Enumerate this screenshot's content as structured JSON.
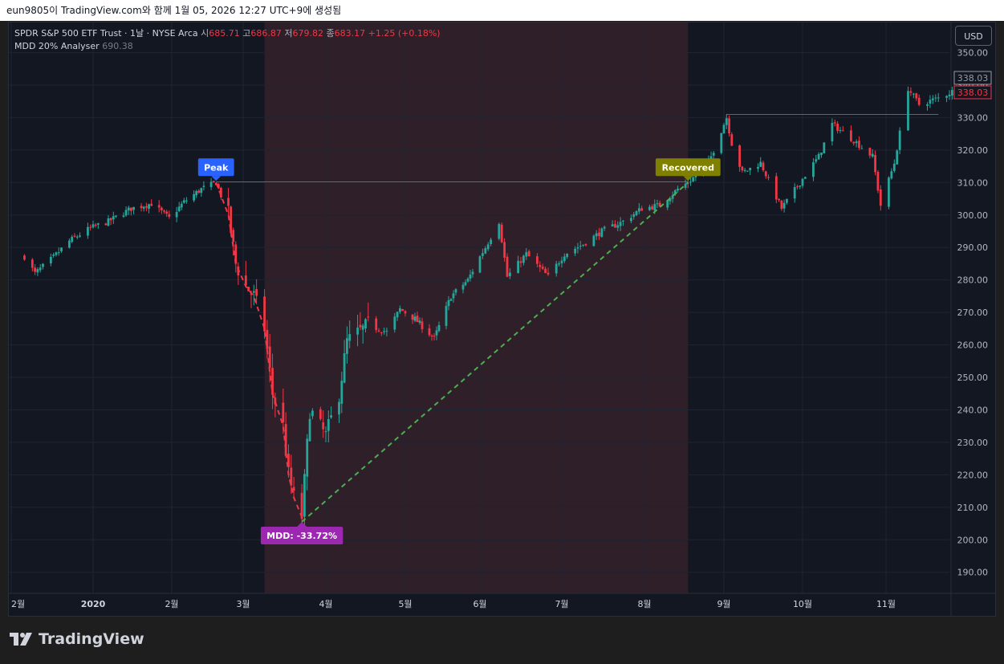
{
  "header": {
    "snapshot_text": "eun9805이 TradingView.com와 함께 1월 05, 2026 12:27 UTC+9에 생성됨"
  },
  "legend": {
    "symbol": "SPDR S&P 500 ETF Trust · 1날 · NYSE Arca",
    "open_label": "시",
    "open_value": "685.71",
    "high_label": "고",
    "high_value": "686.87",
    "low_label": "저",
    "low_value": "679.82",
    "close_label": "종",
    "close_value": "683.17",
    "change": "+1.25 (+0.18%)",
    "indicator_name": "MDD 20% Analyser",
    "indicator_value": "690.38"
  },
  "toolbar": {
    "currency": "USD"
  },
  "footer": {
    "brand": "TradingView"
  },
  "colors": {
    "up": "#26a69a",
    "down": "#f23645",
    "background": "#131722",
    "drawdown_zone": "#2f1f29",
    "peak_label": "#2962ff",
    "recovered_label": "#808000",
    "mdd_label": "#9c27b0",
    "recovery_line": "#4caf50",
    "drop_line": "#f23645"
  },
  "chart_data": {
    "type": "candlestick",
    "y_axis": {
      "min": 184,
      "max": 354,
      "ticks": [
        "190.00",
        "200.00",
        "210.00",
        "220.00",
        "230.00",
        "240.00",
        "250.00",
        "260.00",
        "270.00",
        "280.00",
        "290.00",
        "300.00",
        "310.00",
        "320.00",
        "330.00",
        "340.00",
        "350.00"
      ]
    },
    "x_axis_ticks": [
      {
        "label": "2월",
        "date": "2019-02-01"
      },
      {
        "label": "2020",
        "date": "2020-01-01"
      },
      {
        "label": "2월",
        "date": "2020-02-01"
      },
      {
        "label": "3월",
        "date": "2020-03-01"
      },
      {
        "label": "4월",
        "date": "2020-04-01"
      },
      {
        "label": "5월",
        "date": "2020-05-01"
      },
      {
        "label": "6월",
        "date": "2020-06-01"
      },
      {
        "label": "7월",
        "date": "2020-07-01"
      },
      {
        "label": "8월",
        "date": "2020-08-01"
      },
      {
        "label": "9월",
        "date": "2020-09-01"
      },
      {
        "label": "10월",
        "date": "2020-10-01"
      },
      {
        "label": "11월",
        "date": "2020-11-01"
      }
    ],
    "price_labels": [
      {
        "value": 338.03,
        "text": "338.03",
        "style": "outline"
      },
      {
        "value": 338.03,
        "text": "338.03",
        "style": "current"
      }
    ],
    "peak": {
      "label": "Peak",
      "date": "2020-02-19",
      "price": 310
    },
    "trough": {
      "label": "MDD: -33.72%",
      "date": "2020-03-23",
      "price": 205.5
    },
    "recovered": {
      "label": "Recovered",
      "date": "2020-08-18",
      "price": 310
    },
    "drawdown_zone": {
      "start": "2020-03-09",
      "end": "2020-08-18"
    },
    "high_lines": [
      {
        "from": "2020-02-19",
        "to": "2020-08-18",
        "price": 310.2
      },
      {
        "from": "2020-09-02",
        "to": "2020-11-20",
        "price": 331
      }
    ],
    "closes": [
      {
        "date": "2019-12-06",
        "close": 287.2
      },
      {
        "date": "2019-12-10",
        "close": 282
      },
      {
        "date": "2019-12-17",
        "close": 287
      },
      {
        "date": "2019-12-23",
        "close": 292
      },
      {
        "date": "2019-12-31",
        "close": 296
      },
      {
        "date": "2020-01-07",
        "close": 298
      },
      {
        "date": "2020-01-16",
        "close": 302
      },
      {
        "date": "2020-01-24",
        "close": 303.5
      },
      {
        "date": "2020-01-31",
        "close": 299
      },
      {
        "date": "2020-02-06",
        "close": 304
      },
      {
        "date": "2020-02-13",
        "close": 308
      },
      {
        "date": "2020-02-19",
        "close": 310
      },
      {
        "date": "2020-02-24",
        "close": 300
      },
      {
        "date": "2020-02-27",
        "close": 285
      },
      {
        "date": "2020-03-02",
        "close": 278
      },
      {
        "date": "2020-03-05",
        "close": 275
      },
      {
        "date": "2020-03-09",
        "close": 265
      },
      {
        "date": "2020-03-12",
        "close": 245
      },
      {
        "date": "2020-03-16",
        "close": 235
      },
      {
        "date": "2020-03-18",
        "close": 220
      },
      {
        "date": "2020-03-20",
        "close": 213
      },
      {
        "date": "2020-03-23",
        "close": 207
      },
      {
        "date": "2020-03-26",
        "close": 240
      },
      {
        "date": "2020-04-01",
        "close": 232
      },
      {
        "date": "2020-04-06",
        "close": 245
      },
      {
        "date": "2020-04-09",
        "close": 261
      },
      {
        "date": "2020-04-17",
        "close": 266
      },
      {
        "date": "2020-04-24",
        "close": 264
      },
      {
        "date": "2020-04-29",
        "close": 271
      },
      {
        "date": "2020-05-05",
        "close": 268
      },
      {
        "date": "2020-05-13",
        "close": 262
      },
      {
        "date": "2020-05-20",
        "close": 275
      },
      {
        "date": "2020-05-27",
        "close": 280
      },
      {
        "date": "2020-06-03",
        "close": 290
      },
      {
        "date": "2020-06-08",
        "close": 298
      },
      {
        "date": "2020-06-11",
        "close": 281
      },
      {
        "date": "2020-06-18",
        "close": 288
      },
      {
        "date": "2020-06-26",
        "close": 281
      },
      {
        "date": "2020-07-02",
        "close": 288
      },
      {
        "date": "2020-07-09",
        "close": 291
      },
      {
        "date": "2020-07-16",
        "close": 295
      },
      {
        "date": "2020-07-24",
        "close": 298
      },
      {
        "date": "2020-07-31",
        "close": 302
      },
      {
        "date": "2020-08-07",
        "close": 303
      },
      {
        "date": "2020-08-14",
        "close": 308
      },
      {
        "date": "2020-08-18",
        "close": 310
      },
      {
        "date": "2020-08-26",
        "close": 316
      },
      {
        "date": "2020-09-02",
        "close": 330
      },
      {
        "date": "2020-09-04",
        "close": 322
      },
      {
        "date": "2020-09-08",
        "close": 313
      },
      {
        "date": "2020-09-15",
        "close": 316
      },
      {
        "date": "2020-09-23",
        "close": 302
      },
      {
        "date": "2020-09-30",
        "close": 310
      },
      {
        "date": "2020-10-07",
        "close": 318
      },
      {
        "date": "2020-10-12",
        "close": 328
      },
      {
        "date": "2020-10-20",
        "close": 323
      },
      {
        "date": "2020-10-27",
        "close": 318
      },
      {
        "date": "2020-10-30",
        "close": 303
      },
      {
        "date": "2020-11-04",
        "close": 316
      },
      {
        "date": "2020-11-09",
        "close": 339
      },
      {
        "date": "2020-11-13",
        "close": 334
      },
      {
        "date": "2020-11-20",
        "close": 336
      },
      {
        "date": "2020-11-25",
        "close": 338
      }
    ]
  }
}
